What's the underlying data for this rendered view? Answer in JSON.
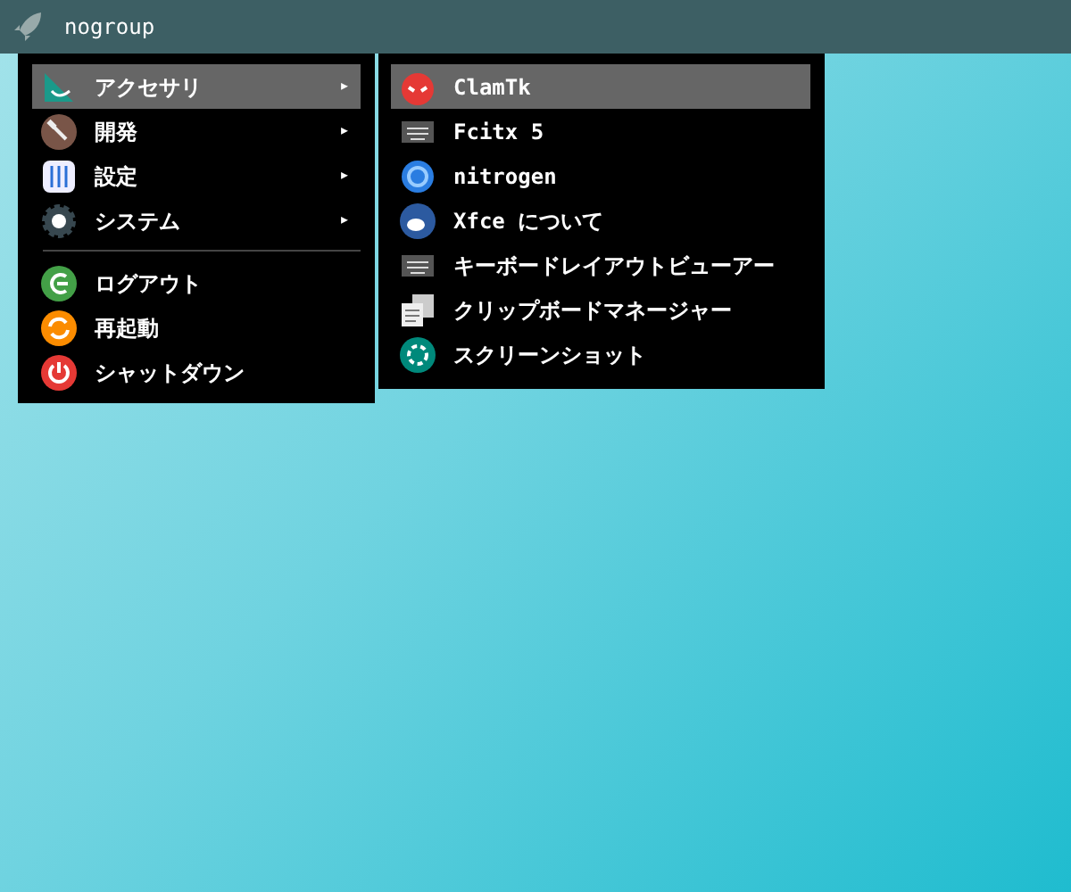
{
  "panel": {
    "title": "nogroup"
  },
  "main_menu": {
    "items": [
      {
        "kind": "submenu",
        "label": "アクセサリ",
        "arrow": "▸",
        "selected": true
      },
      {
        "kind": "submenu",
        "label": "開発",
        "arrow": "▸",
        "selected": false
      },
      {
        "kind": "submenu",
        "label": "設定",
        "arrow": "▸",
        "selected": false
      },
      {
        "kind": "submenu",
        "label": "システム",
        "arrow": "▸",
        "selected": false
      },
      {
        "kind": "separator"
      },
      {
        "kind": "action",
        "label": "ログアウト",
        "selected": false
      },
      {
        "kind": "action",
        "label": "再起動",
        "selected": false
      },
      {
        "kind": "action",
        "label": "シャットダウン",
        "selected": false
      }
    ]
  },
  "submenu": {
    "items": [
      {
        "label": "ClamTk",
        "selected": true
      },
      {
        "label": "Fcitx 5",
        "selected": false
      },
      {
        "label": "nitrogen",
        "selected": false
      },
      {
        "label": "Xfce について",
        "selected": false
      },
      {
        "label": "キーボードレイアウトビューアー",
        "selected": false
      },
      {
        "label": "クリップボードマネージャー",
        "selected": false
      },
      {
        "label": "スクリーンショット",
        "selected": false
      }
    ]
  }
}
